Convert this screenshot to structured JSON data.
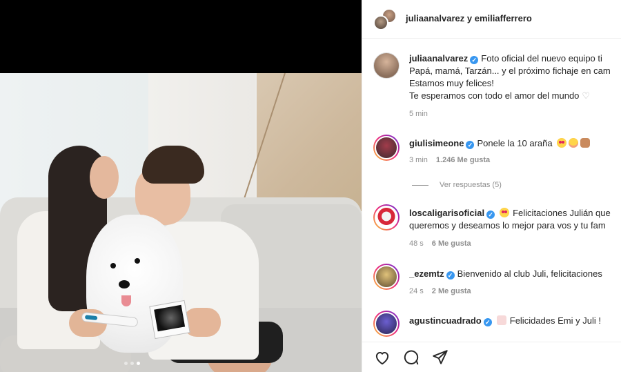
{
  "post": {
    "carousel_count": 3,
    "carousel_active": 3
  },
  "header": {
    "title": "juliaanalvarez y emiliafferrero"
  },
  "caption": {
    "username": "juliaanalvarez",
    "lines": [
      "Foto oficial del nuevo equipo ti",
      "Papá, mamá, Tarzán... y el próximo fichaje en cam",
      "Estamos muy felices!",
      "Te esperamos con todo el amor del mundo"
    ],
    "time": "5 min"
  },
  "comments": [
    {
      "username": "giulisimeone",
      "verified": true,
      "lines": [
        "Ponele la 10 araña"
      ],
      "emoji": [
        "heart-eyes",
        "blush",
        "hands"
      ],
      "time": "3 min",
      "likes": "1.246 Me gusta",
      "replies": "Ver respuestas (5)"
    },
    {
      "username": "loscaligarisoficial",
      "verified": true,
      "lines": [
        "Felicitaciones Julián que",
        "queremos y deseamos lo mejor para vos y tu fam"
      ],
      "emoji": [
        "heart-eyes"
      ],
      "time": "48 s",
      "likes": "6 Me gusta"
    },
    {
      "username": "_ezemtz",
      "verified": true,
      "lines": [
        "Bienvenido al club Juli, felicitaciones"
      ],
      "time": "24 s",
      "likes": "2 Me gusta"
    },
    {
      "username": "agustincuadrado",
      "verified": true,
      "lines": [
        "Felicidades Emi y Juli !"
      ],
      "emoji": [
        "cake"
      ]
    }
  ],
  "actions": {
    "like_icon": "heart-outline-icon",
    "comment_icon": "comment-bubble-icon",
    "share_icon": "paper-plane-icon"
  },
  "colors": {
    "verified": "#3897f0",
    "muted": "#8e8e8e",
    "text": "#262626"
  }
}
